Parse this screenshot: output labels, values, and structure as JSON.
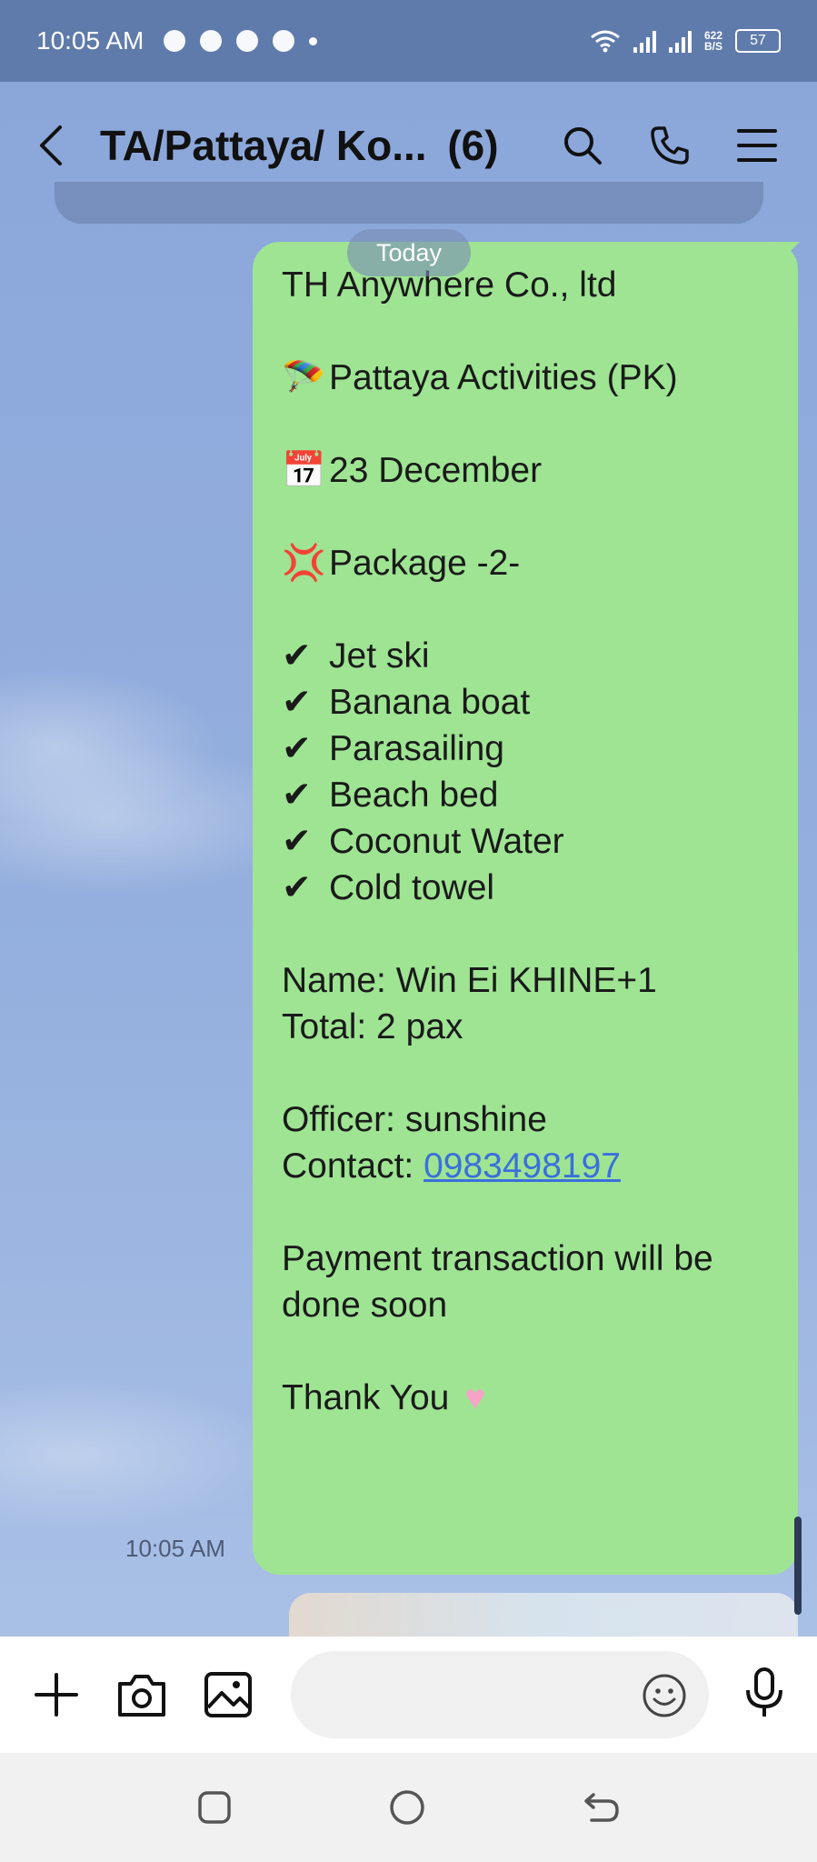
{
  "status_bar": {
    "time": "10:05 AM",
    "speed_value": "622",
    "speed_unit": "B/S",
    "battery": "57"
  },
  "header": {
    "title": "TA/Pattaya/ Ko...",
    "member_count": "(6)"
  },
  "chat": {
    "date_divider": "Today",
    "message_time": "10:05 AM",
    "message": {
      "company": "TH Anywhere Co., ltd",
      "activity": "Pattaya Activities (PK)",
      "date": "23 December",
      "package": "Package -2-",
      "items": [
        "Jet ski",
        "Banana boat",
        "Parasailing",
        "Beach bed",
        "Coconut Water",
        "Cold towel"
      ],
      "name_line": "Name: Win Ei KHINE+1",
      "total_line": "Total: 2 pax",
      "officer_line": "Officer: sunshine",
      "contact_label": "Contact: ",
      "contact_number": "0983498197",
      "payment_line1": "Payment transaction will be",
      "payment_line2": "done soon",
      "thanks": "Thank You"
    }
  },
  "input": {
    "placeholder": ""
  },
  "colors": {
    "status_bar": "#5f7bab",
    "bubble": "#9ee493",
    "link": "#3b6fdc"
  }
}
